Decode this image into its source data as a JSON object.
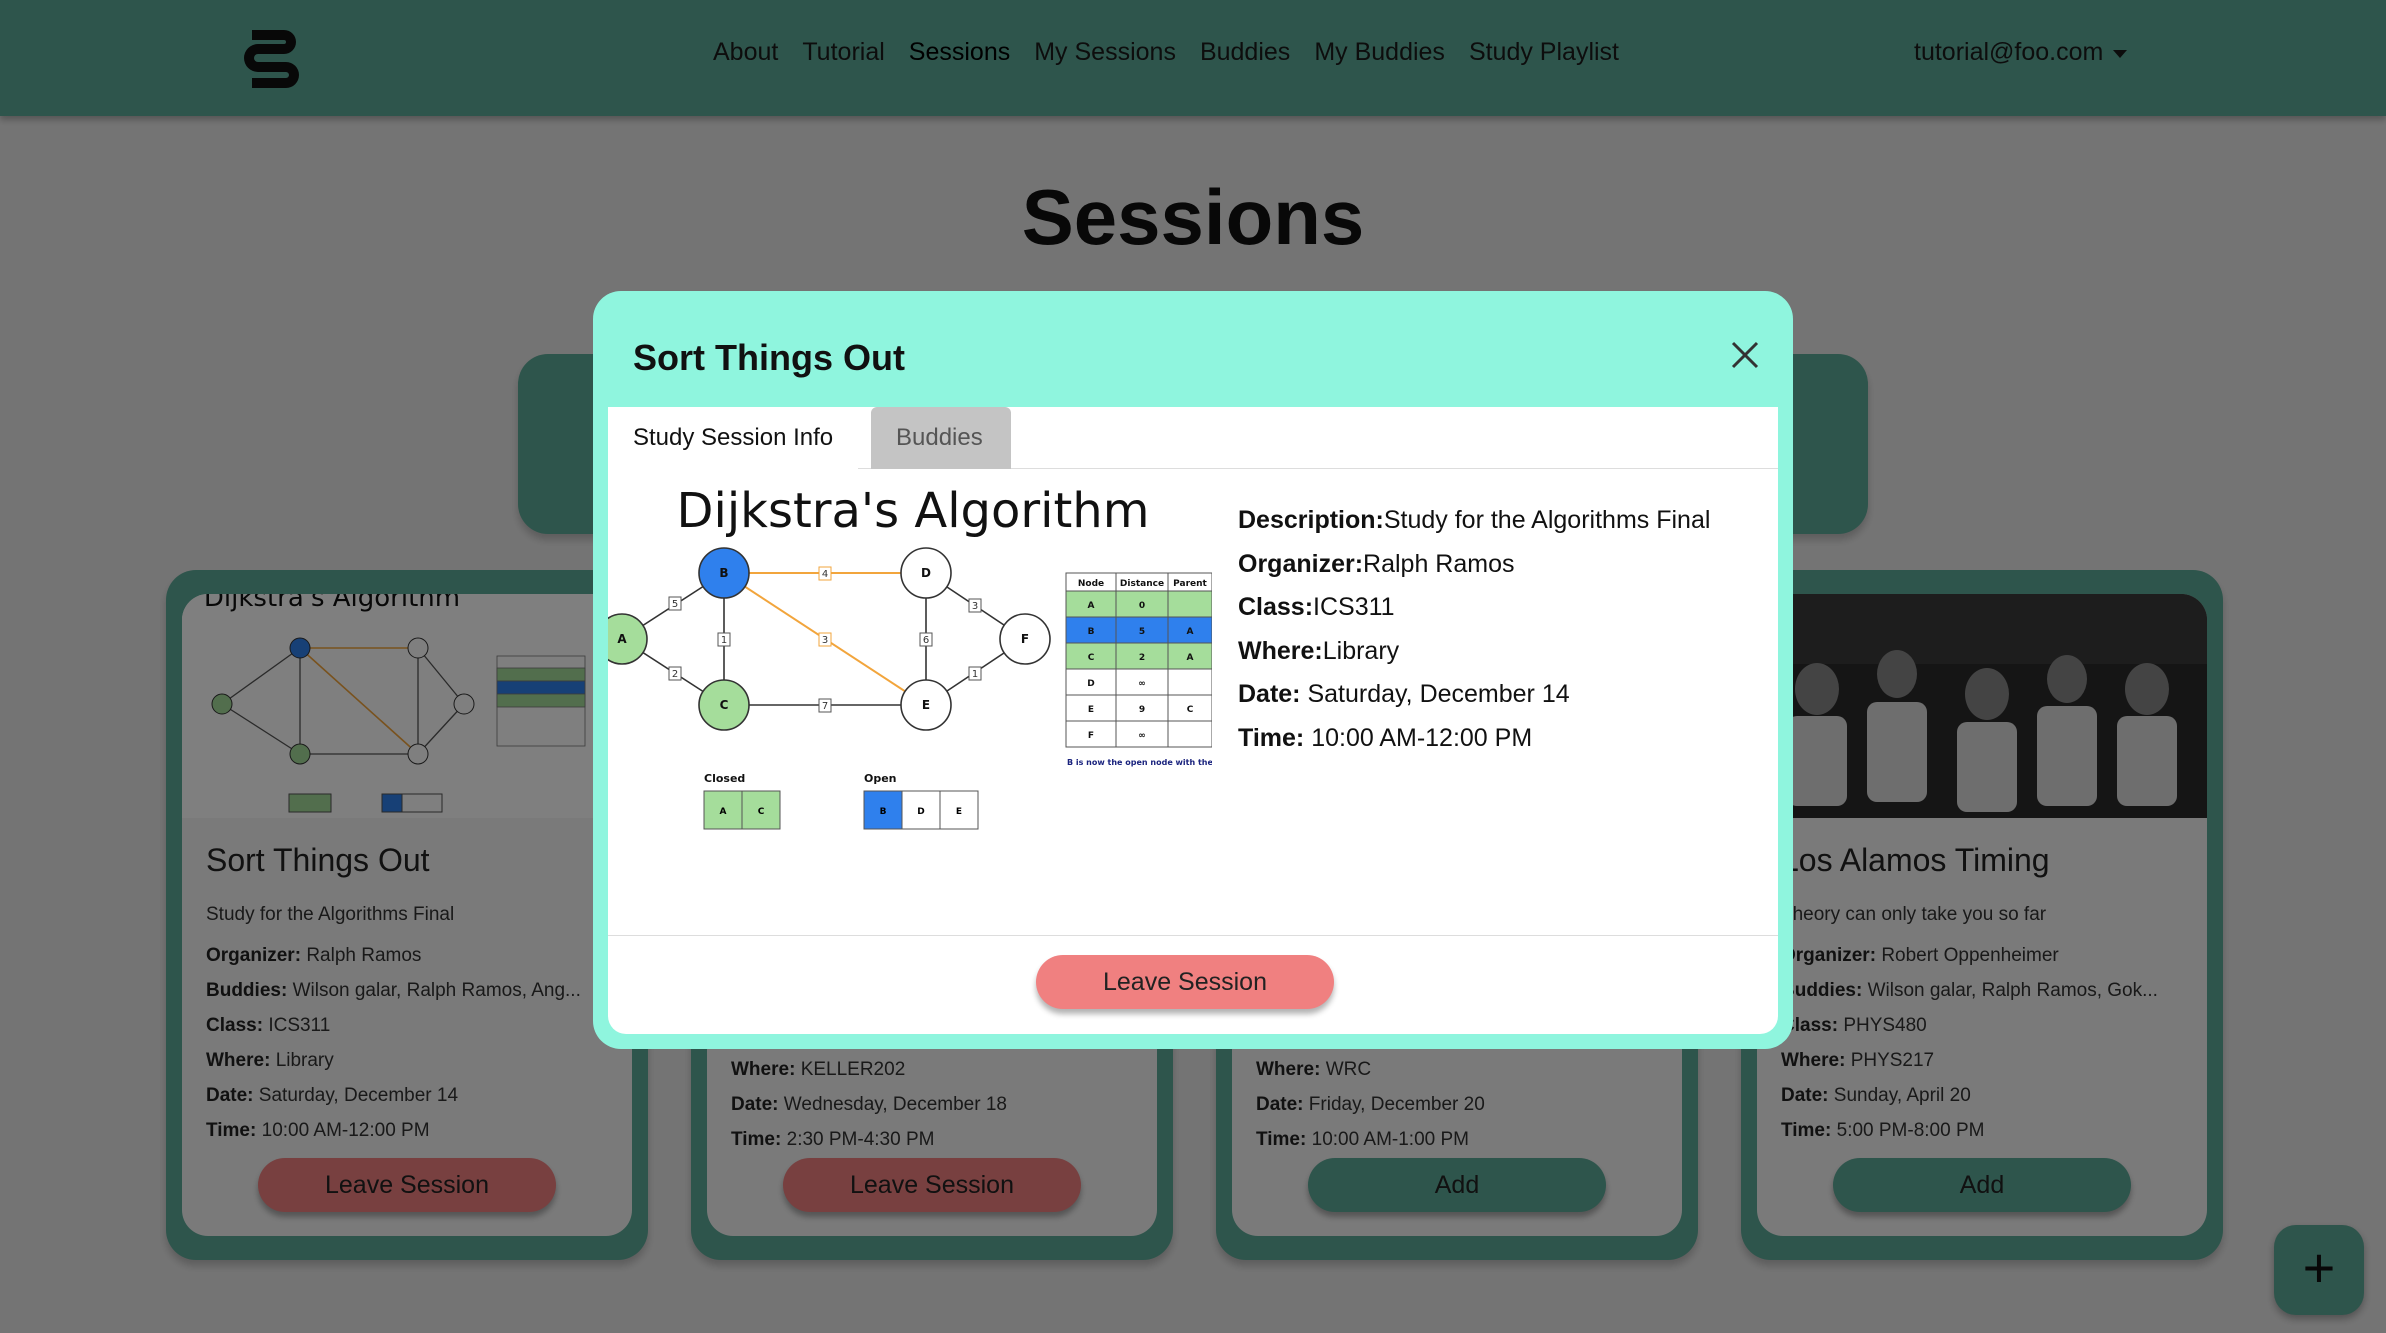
{
  "nav": {
    "links": [
      "About",
      "Tutorial",
      "Sessions",
      "My Sessions",
      "Buddies",
      "My Buddies",
      "Study Playlist"
    ],
    "user_email": "tutorial@foo.com"
  },
  "page": {
    "title": "Sessions"
  },
  "cards": [
    {
      "title": "Sort Things Out",
      "description": "Study for the Algorithms Final",
      "organizer_label": "Organizer:",
      "organizer": "Ralph Ramos",
      "buddies_label": "Buddies:",
      "buddies": "Wilson galar, Ralph Ramos, Ang...",
      "class_label": "Class:",
      "class": "ICS311",
      "where_label": "Where:",
      "where": "Library",
      "date_label": "Date:",
      "date": "Saturday, December 14",
      "time_label": "Time:",
      "time": "10:00 AM-12:00 PM",
      "button": "Leave Session",
      "image_caption": "Dijkstra's Algorithm"
    },
    {
      "title": "",
      "description": "",
      "organizer_label": "",
      "organizer": "",
      "buddies_label": "",
      "buddies": "",
      "class_label": "",
      "class": "",
      "where_label": "Where:",
      "where": "KELLER202",
      "date_label": "Date:",
      "date": "Wednesday, December 18",
      "time_label": "Time:",
      "time": "2:30 PM-4:30 PM",
      "button": "Leave Session"
    },
    {
      "title": "",
      "description": "",
      "organizer_label": "",
      "organizer": "",
      "buddies_label": "",
      "buddies": "",
      "class_label": "",
      "class": "",
      "where_label": "Where:",
      "where": "WRC",
      "date_label": "Date:",
      "date": "Friday, December 20",
      "time_label": "Time:",
      "time": "10:00 AM-1:00 PM",
      "button": "Add"
    },
    {
      "title": "Los Alamos Timing",
      "description": "Theory can only take you so far",
      "organizer_label": "Organizer:",
      "organizer": "Robert Oppenheimer",
      "buddies_label": "Buddies:",
      "buddies": "Wilson galar, Ralph Ramos, Gok...",
      "class_label": "Class:",
      "class": "PHYS480",
      "where_label": "Where:",
      "where": "PHYS217",
      "date_label": "Date:",
      "date": "Sunday, April 20",
      "time_label": "Time:",
      "time": "5:00 PM-8:00 PM",
      "button": "Add"
    }
  ],
  "fab": {
    "label": "+"
  },
  "modal": {
    "title": "Sort Things Out",
    "tabs": [
      "Study Session Info",
      "Buddies"
    ],
    "image": {
      "title": "Dijkstra's Algorithm",
      "nodes": [
        "A",
        "B",
        "C",
        "D",
        "E",
        "F"
      ],
      "edge_weights": [
        "5",
        "4",
        "1",
        "3",
        "6",
        "2",
        "3",
        "7",
        "1"
      ],
      "table_headers": [
        "Node",
        "Distance",
        "Parent"
      ],
      "table_rows": [
        [
          "A",
          "0",
          ""
        ],
        [
          "B",
          "5",
          "A"
        ],
        [
          "C",
          "2",
          "A"
        ],
        [
          "D",
          "∞",
          ""
        ],
        [
          "E",
          "9",
          "C"
        ],
        [
          "F",
          "∞",
          ""
        ]
      ],
      "note": "B is now the open node with the smallest distance",
      "closed_label": "Closed",
      "closed": [
        "A",
        "C"
      ],
      "open_label": "Open",
      "open": [
        "B",
        "D",
        "E"
      ]
    },
    "details": {
      "description_label": "Description:",
      "description": "Study for the Algorithms Final",
      "organizer_label": "Organizer:",
      "organizer": "Ralph Ramos",
      "class_label": "Class:",
      "class": "ICS311",
      "where_label": "Where:",
      "where": "Library",
      "date_label": "Date:",
      "date": "Saturday, December 14",
      "time_label": "Time:",
      "time": "10:00 AM-12:00 PM"
    },
    "leave_button": "Leave Session"
  },
  "colors": {
    "primary": "#5daa98",
    "modal_bg": "#8ff5de",
    "leave": "#f08080",
    "node_blue": "#2f80ed",
    "node_green": "#a5dd9b",
    "path_orange": "#f2a53c"
  }
}
